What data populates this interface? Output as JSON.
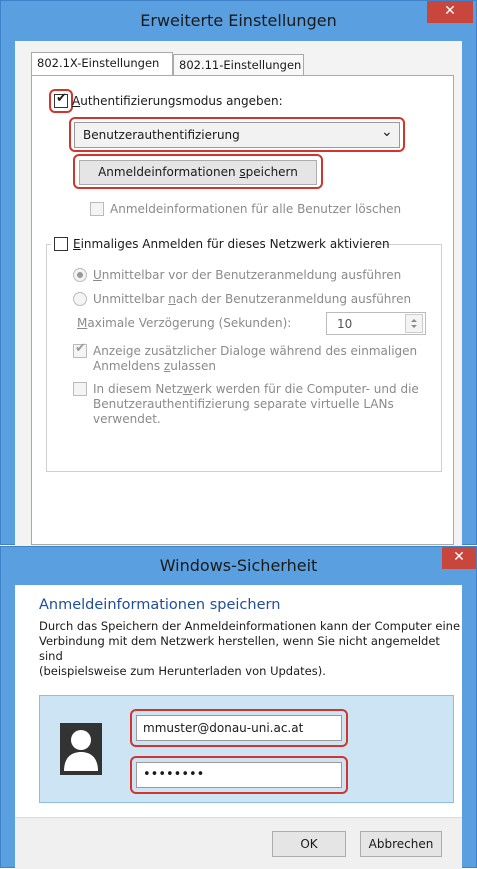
{
  "advanced_dialog": {
    "title": "Erweiterte Einstellungen",
    "close_glyph": "✕",
    "tabs": [
      {
        "label": "802.1X-Einstellungen"
      },
      {
        "label": "802.11-Einstellungen"
      }
    ],
    "auth_mode": {
      "label_mnemonic": "A",
      "label_rest": "uthentifizierungsmodus angeben:",
      "checked_glyph": "✔",
      "selected": "Benutzerauthentifizierung",
      "dropdown_glyph": "⌄"
    },
    "save_credentials_button": {
      "pre": "Anmeldeinformationen ",
      "mnemonic": "s",
      "post": "peichern"
    },
    "delete_credentials_label": "Anmeldeinformationen für alle Benutzer löschen",
    "sso": {
      "label_mnemonic": "E",
      "label_rest": "inmaliges Anmelden für dieses Netzwerk aktivieren",
      "radio_before": {
        "mnemonic": "U",
        "rest": "nmittelbar vor der Benutzeranmeldung ausführen"
      },
      "radio_after": {
        "pre": "Unmittelbar ",
        "mnemonic": "n",
        "post": "ach der Benutzeranmeldung ausführen"
      },
      "max_delay": {
        "mnemonic": "M",
        "rest": "aximale Verzögerung (Sekunden):",
        "value": "10"
      },
      "extra_dialogs": {
        "line1": "Anzeige zusätzlicher Dialoge während des einmaligen",
        "line2_pre": "Anmeldens ",
        "line2_mnemonic": "z",
        "line2_post": "ulassen",
        "checked_glyph": "✔"
      },
      "separate_vlans": {
        "line1_pre": "In diesem Netz",
        "line1_mnemonic": "w",
        "line1_post": "erk werden für die Computer- und die",
        "line2": "Benutzerauthentifizierung separate virtuelle LANs",
        "line3": "verwendet."
      }
    }
  },
  "security_dialog": {
    "title": "Windows-Sicherheit",
    "close_glyph": "✕",
    "heading": "Anmeldeinformationen speichern",
    "description_lines": [
      "Durch das Speichern der Anmeldeinformationen kann der Computer eine",
      "Verbindung mit dem Netzwerk herstellen, wenn Sie nicht angemeldet sind",
      "(beispielsweise zum Herunterladen von Updates)."
    ],
    "username": "mmuster@donau-uni.ac.at",
    "password_masked": "••••••••",
    "ok_label": "OK",
    "cancel_label": "Abbrechen"
  },
  "colors": {
    "title_bar": "#5a9fe0",
    "close_button": "#c9463d",
    "highlight_box": "#d2352c",
    "heading_blue": "#1f4e99",
    "credential_panel": "#cde4f5"
  }
}
